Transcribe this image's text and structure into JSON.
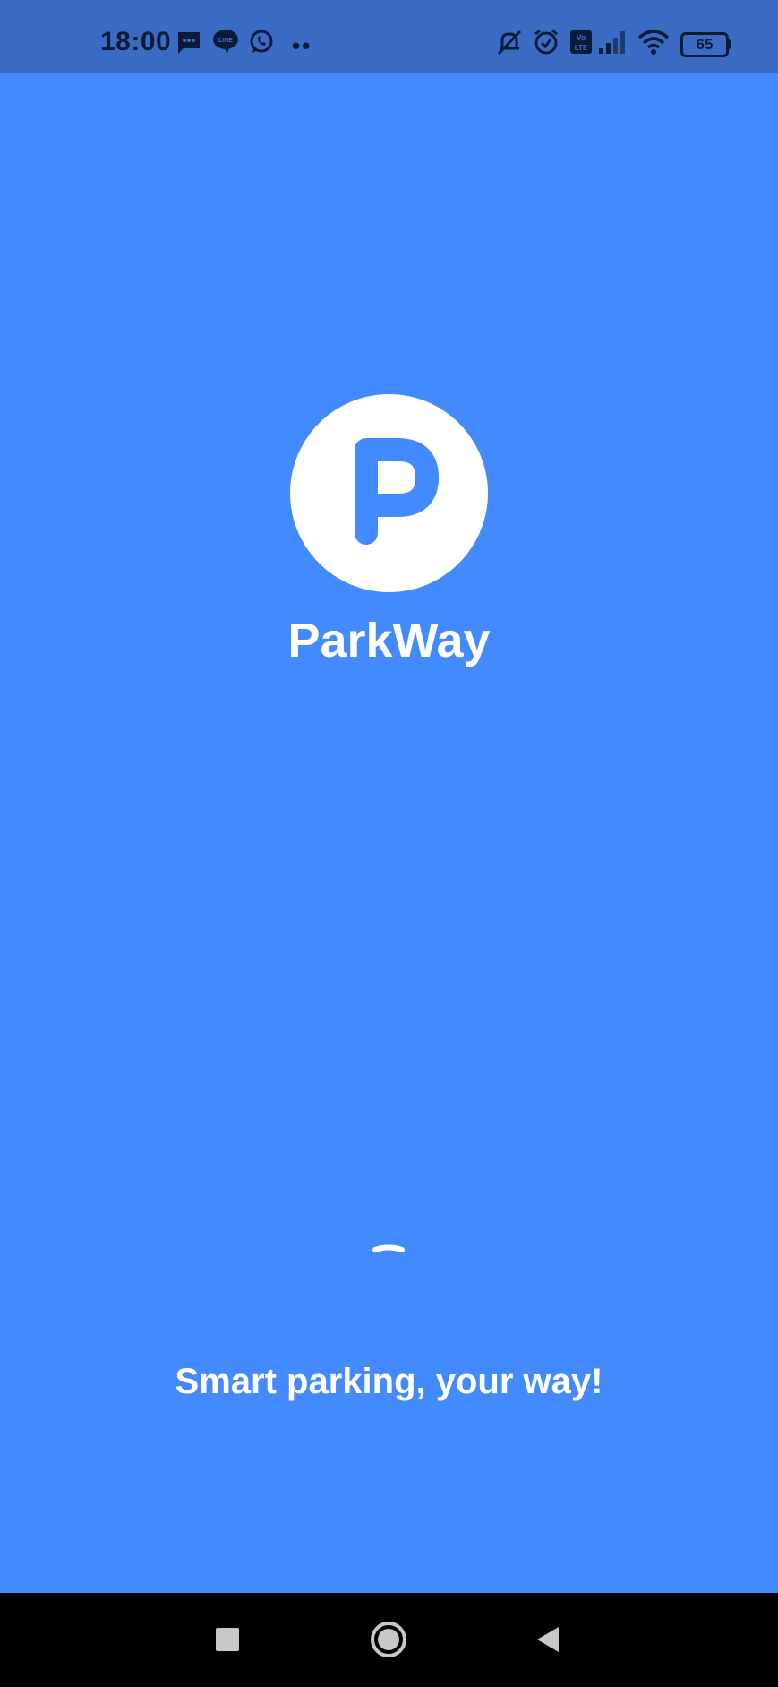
{
  "status_bar": {
    "time": "18:00",
    "battery": "65",
    "notification_icons": [
      "message-icon",
      "line-icon",
      "whatsapp-icon",
      "more-notifications-icon"
    ],
    "system_icons": [
      "mute-icon",
      "alarm-icon",
      "volte-icon",
      "signal-icon",
      "wifi-icon",
      "battery-icon"
    ]
  },
  "splash": {
    "logo_letter": "P",
    "app_name": "ParkWay",
    "tagline": "Smart parking, your way!"
  },
  "navigation_bar": {
    "buttons": [
      "recents-button",
      "home-button",
      "back-button"
    ]
  },
  "colors": {
    "background": "#448aff",
    "status_bar": "#3a6cc4",
    "logo_circle": "#ffffff",
    "text": "#ffffff",
    "nav_bar": "#000000"
  }
}
